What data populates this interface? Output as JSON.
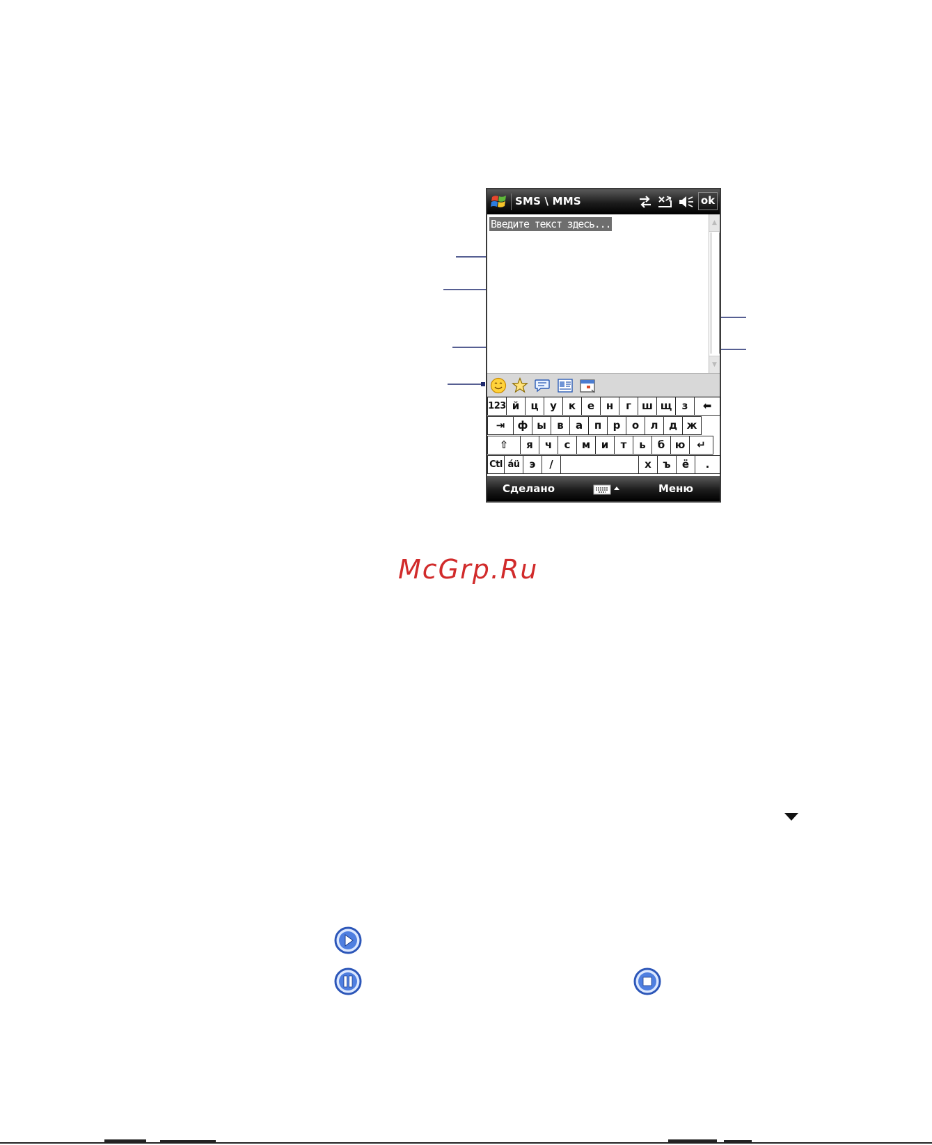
{
  "window": {
    "title": "SMS \\ MMS",
    "ok_label": "ok"
  },
  "editor": {
    "placeholder": "Введите текст здесь..."
  },
  "toolbar": {
    "icons": [
      "smiley-icon",
      "star-icon",
      "speech-bubble-icon",
      "contact-card-icon",
      "calendar-icon"
    ]
  },
  "keyboard": {
    "row1": [
      "123",
      "й",
      "ц",
      "у",
      "к",
      "е",
      "н",
      "г",
      "ш",
      "щ",
      "з",
      "⬅"
    ],
    "row2": [
      "⇥",
      "ф",
      "ы",
      "в",
      "а",
      "п",
      "р",
      "о",
      "л",
      "д",
      "ж"
    ],
    "row3": [
      "⇧",
      "я",
      "ч",
      "с",
      "м",
      "и",
      "т",
      "ь",
      "б",
      "ю",
      "↵"
    ],
    "row4": [
      "Ctl",
      "áü",
      "э",
      "/",
      "",
      "х",
      "ъ",
      "ё",
      "."
    ]
  },
  "softkeys": {
    "left": "Сделано",
    "right": "Меню"
  },
  "watermark": "McGrp.Ru",
  "colors": {
    "bar_dark": "#1c1c1c",
    "callout_line": "#1f2a6e",
    "watermark": "#d12b2b",
    "media_blue": "#2c56b8"
  }
}
